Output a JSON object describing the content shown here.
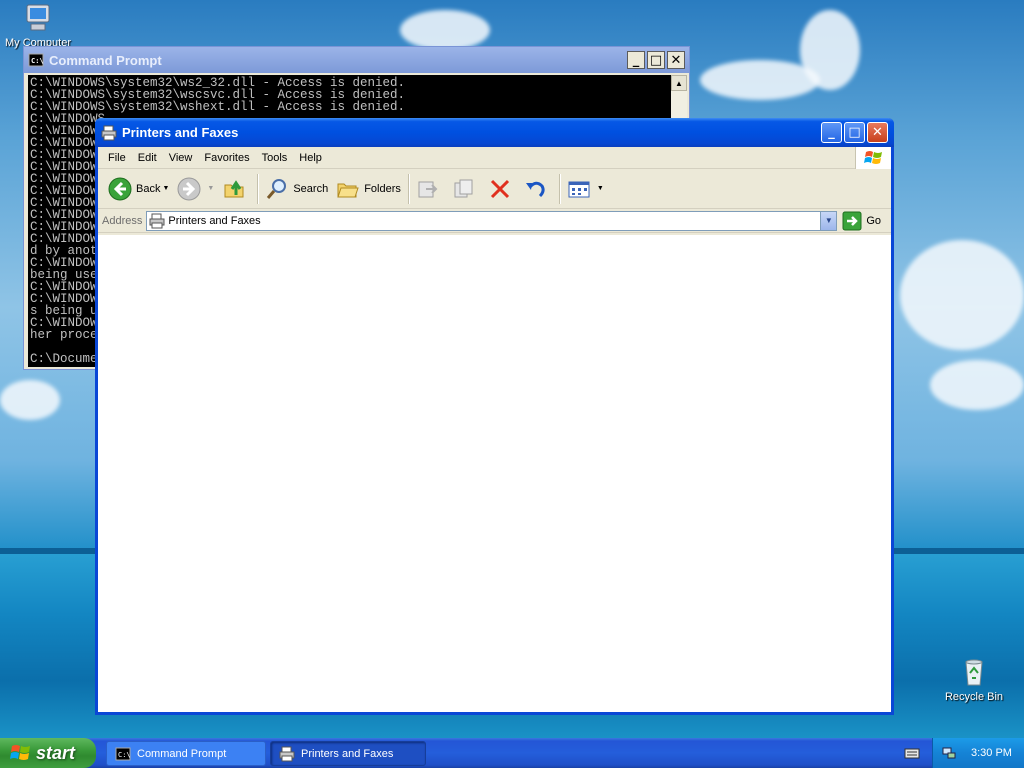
{
  "desktop": {
    "icons": [
      {
        "label": "My Computer",
        "icon": "my-computer-icon"
      },
      {
        "label": "Recycle Bin",
        "icon": "recycle-bin-icon"
      }
    ]
  },
  "cmd": {
    "title": "Command Prompt",
    "lines": [
      "C:\\WINDOWS\\system32\\ws2_32.dll - Access is denied.",
      "C:\\WINDOWS\\system32\\wscsvc.dll - Access is denied.",
      "C:\\WINDOWS\\system32\\wshext.dll - Access is denied.",
      "C:\\WINDOWS",
      "C:\\WINDOW",
      "C:\\WINDOW",
      "C:\\WINDOW",
      "C:\\WINDOW",
      "C:\\WINDOW",
      "C:\\WINDOW",
      "C:\\WINDOW",
      "C:\\WINDOW",
      "C:\\WINDOW",
      "C:\\WINDOW",
      "d by anot",
      "C:\\WINDOW",
      "being use",
      "C:\\WINDOW",
      "C:\\WINDOW",
      "s being u",
      "C:\\WINDOW",
      "her proce",
      "",
      "C:\\Docume"
    ]
  },
  "explorer": {
    "title": "Printers and Faxes",
    "menu": [
      "File",
      "Edit",
      "View",
      "Favorites",
      "Tools",
      "Help"
    ],
    "toolbar": {
      "back": "Back",
      "search": "Search",
      "folders": "Folders"
    },
    "address": {
      "label": "Address",
      "value": "Printers and Faxes",
      "go": "Go"
    }
  },
  "taskbar": {
    "start": "start",
    "tasks": [
      {
        "label": "Command Prompt",
        "active": false
      },
      {
        "label": "Printers and Faxes",
        "active": true
      }
    ],
    "clock": "3:30 PM"
  }
}
